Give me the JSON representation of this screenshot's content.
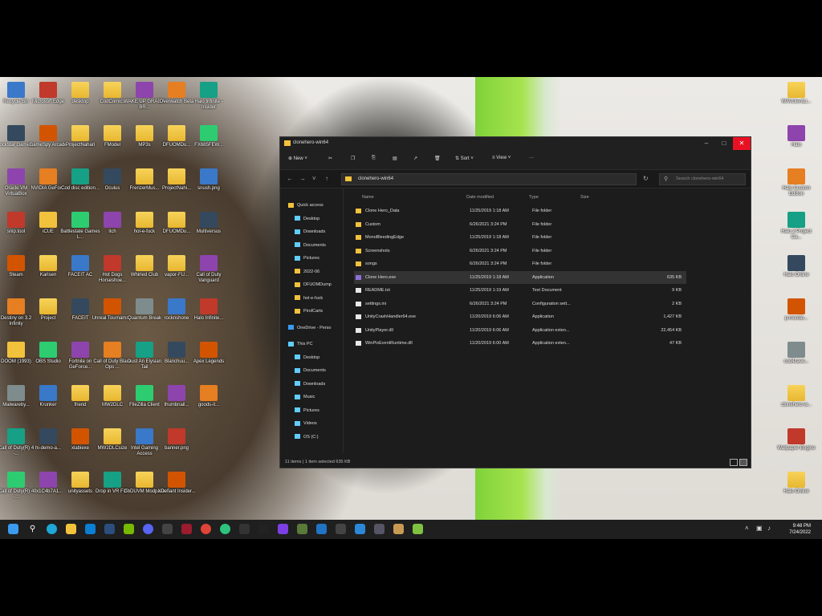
{
  "desktop_icons": [
    "Recycle Bin",
    "Microsoft Edge",
    "desktop",
    "CodComics",
    "WAKE UP GRAB A BR...",
    "Overwatch Beta",
    "Halo Infinite - Insider",
    "Rockstar Games...",
    "GameSpy Arcade",
    "ProjectNahari",
    "FModel",
    "MP3s",
    "DFUOMDu...",
    "FX685FEW...",
    "Oracle VM VirtualBox",
    "NVIDIA GeFor...",
    "Cod disc edition...",
    "Oculus",
    "FrenzerMus...",
    "ProjectNahi...",
    "snush.png",
    "snip.tool",
    "iCUE",
    "Battlestate Games L...",
    "itch",
    "hol-e-fuck",
    "DFUOMDu...",
    "Multiversus",
    "Steam",
    "Karlsen",
    "FACEIT AC",
    "Hot Dogs Horseshoe...",
    "Whirled Club",
    "vapor-FU...",
    "Call of Duty Vanguard",
    "Destiny on 3.2 Infinity",
    "Project",
    "FACEIT",
    "Unreal Tournams...",
    "Quantum Break",
    "rocknshone",
    "Halo Infinite...",
    "DOOM (1993)",
    "OBS Studio",
    "Fortnite on GeForce...",
    "Call of Duty Black Ops ...",
    "Dust An Elysian Tail",
    "Blanchuu...",
    "Apex Legends",
    "Malwareby...",
    "Krunker",
    "friend",
    "MW2DLC",
    "FileZilla Client",
    "thumbnail...",
    "goods-it...",
    "Call of Duty(R) 4 -...",
    "hi-demo-a...",
    "xlabiexe",
    "MW2DLCsize",
    "Intel Gaming Access",
    "banner.png",
    "",
    "Call of Duty(R) 4 -...",
    "0x1C4b7A1...",
    "unityassets",
    "Drop in VR F2P",
    "CoDUVM Modpack",
    "XDefiant Insider..."
  ],
  "right_icons": [
    "WAVclientLi...",
    "Halo",
    "Halo Custom Edition",
    "Halo 2 Project Ca...",
    "Halo Online",
    "p.mondo...",
    "cod4cave...",
    "clonehero-w...",
    "Wallpaper Engine",
    "Halo Online"
  ],
  "window": {
    "title": "clonehero-win64",
    "new_label": "New",
    "sort_label": "Sort",
    "view_label": "View",
    "more_label": "···",
    "address": "clonehero-win64",
    "search_placeholder": "Search clonehero-win64",
    "columns": [
      "Name",
      "Date modified",
      "Type",
      "Size"
    ],
    "nav": {
      "quick_access": "Quick access",
      "pinned": [
        "Desktop",
        "Downloads",
        "Documents",
        "Pictures"
      ],
      "recent": [
        "2022-06",
        "DFUOMDump",
        "hol-e-fuck",
        "PirolCarts"
      ],
      "onedrive": "OneDrive - Perso",
      "this_pc": "This PC",
      "pc_items": [
        "Desktop",
        "Documents",
        "Downloads",
        "Music",
        "Pictures",
        "Videos",
        "OS (C:)"
      ]
    },
    "files": [
      {
        "name": "Clone Hero_Data",
        "date": "11/25/2019 1:18 AM",
        "type": "File folder",
        "size": "",
        "kind": "folder"
      },
      {
        "name": "Custom",
        "date": "6/26/2021 3:24 PM",
        "type": "File folder",
        "size": "",
        "kind": "folder"
      },
      {
        "name": "MonoBleedingEdge",
        "date": "11/25/2019 1:18 AM",
        "type": "File folder",
        "size": "",
        "kind": "folder"
      },
      {
        "name": "Screenshots",
        "date": "6/26/2021 3:24 PM",
        "type": "File folder",
        "size": "",
        "kind": "folder"
      },
      {
        "name": "songs",
        "date": "6/26/2021 3:24 PM",
        "type": "File folder",
        "size": "",
        "kind": "folder"
      },
      {
        "name": "Clone Hero.exe",
        "date": "11/25/2019 1:18 AM",
        "type": "Application",
        "size": "635 KB",
        "kind": "app"
      },
      {
        "name": "README.txt",
        "date": "11/25/2019 1:19 AM",
        "type": "Text Document",
        "size": "9 KB",
        "kind": "file"
      },
      {
        "name": "settings.ini",
        "date": "6/26/2021 3:24 PM",
        "type": "Configuration sett...",
        "size": "2 KB",
        "kind": "file"
      },
      {
        "name": "UnityCrashHandler64.exe",
        "date": "11/20/2019 6:06 AM",
        "type": "Application",
        "size": "1,427 KB",
        "kind": "file"
      },
      {
        "name": "UnityPlayer.dll",
        "date": "11/20/2019 6:06 AM",
        "type": "Application exten...",
        "size": "22,454 KB",
        "kind": "file"
      },
      {
        "name": "WinPixEventRuntime.dll",
        "date": "11/20/2019 6:00 AM",
        "type": "Application exten...",
        "size": "47 KB",
        "kind": "file"
      }
    ],
    "status": "11 items   |   1 item selected  635 KB"
  },
  "clock": {
    "time": "9:48 PM",
    "date": "7/24/2022"
  },
  "colors": {
    "folder": "#f3c23c",
    "accent": "#60cdff",
    "close": "#e81123"
  }
}
